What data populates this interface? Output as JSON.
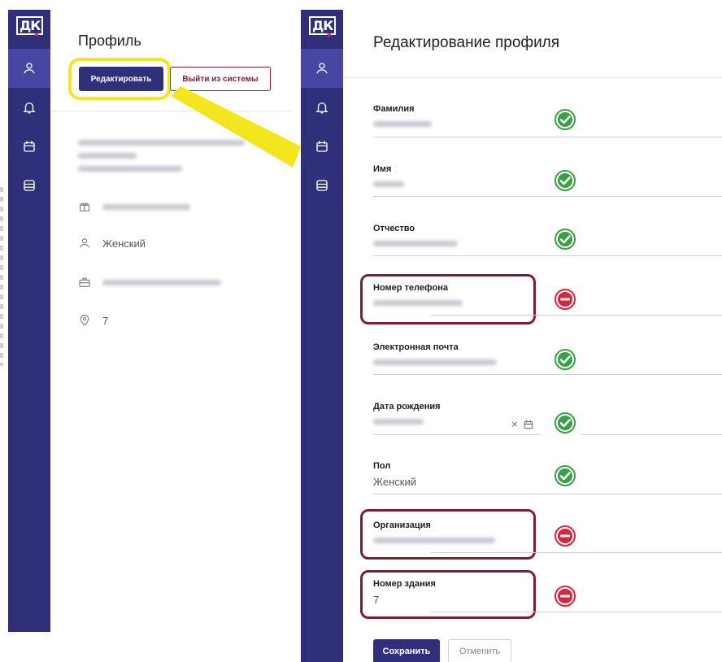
{
  "brand": {
    "logo_text": "ДК",
    "heart": "♥"
  },
  "colors": {
    "sidebar": "#30307a",
    "primary": "#30307a",
    "accent_red": "#8a1c3a",
    "highlight_yellow": "#f3e61c",
    "ok_green": "#3aa046",
    "error_red": "#d7263d"
  },
  "nav": [
    {
      "icon": "user-icon"
    },
    {
      "icon": "bell-icon"
    },
    {
      "icon": "calendar-icon"
    },
    {
      "icon": "storage-icon"
    }
  ],
  "profile": {
    "title": "Профиль",
    "edit_label": "Редактировать",
    "logout_label": "Выйти из системы",
    "gender": "Женский",
    "building": "7"
  },
  "edit_form": {
    "title": "Редактирование профиля",
    "fields": [
      {
        "label": "Фамилия",
        "value": "",
        "status": "ok"
      },
      {
        "label": "Имя",
        "value": "",
        "status": "ok"
      },
      {
        "label": "Отчество",
        "value": "",
        "status": "ok"
      },
      {
        "label": "Номер телефона",
        "value": "",
        "status": "error"
      },
      {
        "label": "Электронная почта",
        "value": "",
        "status": "ok"
      },
      {
        "label": "Дата рождения",
        "value": "",
        "status": "ok"
      },
      {
        "label": "Пол",
        "value": "Женский",
        "status": "ok"
      },
      {
        "label": "Организация",
        "value": "",
        "status": "error"
      },
      {
        "label": "Номер здания",
        "value": "7",
        "status": "error"
      }
    ],
    "date_clear": "×",
    "save_label": "Сохранить",
    "cancel_label": "Отменить"
  }
}
